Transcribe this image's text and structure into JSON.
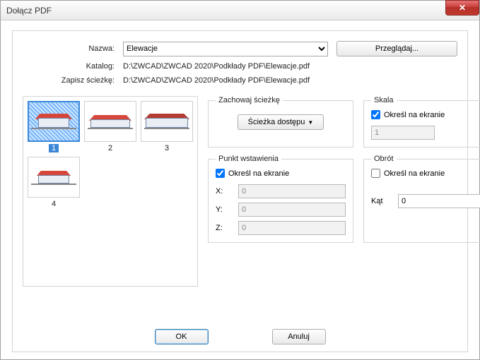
{
  "window": {
    "title": "Dołącz PDF"
  },
  "top": {
    "name_label": "Nazwa:",
    "name_value": "Elewacje",
    "browse_label": "Przeglądaj...",
    "catalog_label": "Katalog:",
    "catalog_value": "D:\\ZWCAD\\ZWCAD 2020\\Podkłady PDF\\Elewacje.pdf",
    "savepath_label": "Zapisz ścieżkę:",
    "savepath_value": "D:\\ZWCAD\\ZWCAD 2020\\Podkłady PDF\\Elewacje.pdf"
  },
  "thumbs": {
    "pages": [
      "1",
      "2",
      "3",
      "4"
    ],
    "selected": "1"
  },
  "keep_path": {
    "legend": "Zachowaj ścieżkę",
    "button": "Ścieżka dostępu"
  },
  "scale": {
    "legend": "Skala",
    "on_screen": "Określ na ekranie",
    "value": "1",
    "checked": true
  },
  "insert_point": {
    "legend": "Punkt wstawienia",
    "on_screen": "Określ na ekranie",
    "checked": true,
    "x_label": "X:",
    "y_label": "Y:",
    "z_label": "Z:",
    "x": "0",
    "y": "0",
    "z": "0"
  },
  "rotation": {
    "legend": "Obrót",
    "on_screen": "Określ na ekranie",
    "checked": false,
    "angle_label": "Kąt",
    "angle": "0"
  },
  "footer": {
    "ok": "OK",
    "cancel": "Anuluj"
  }
}
